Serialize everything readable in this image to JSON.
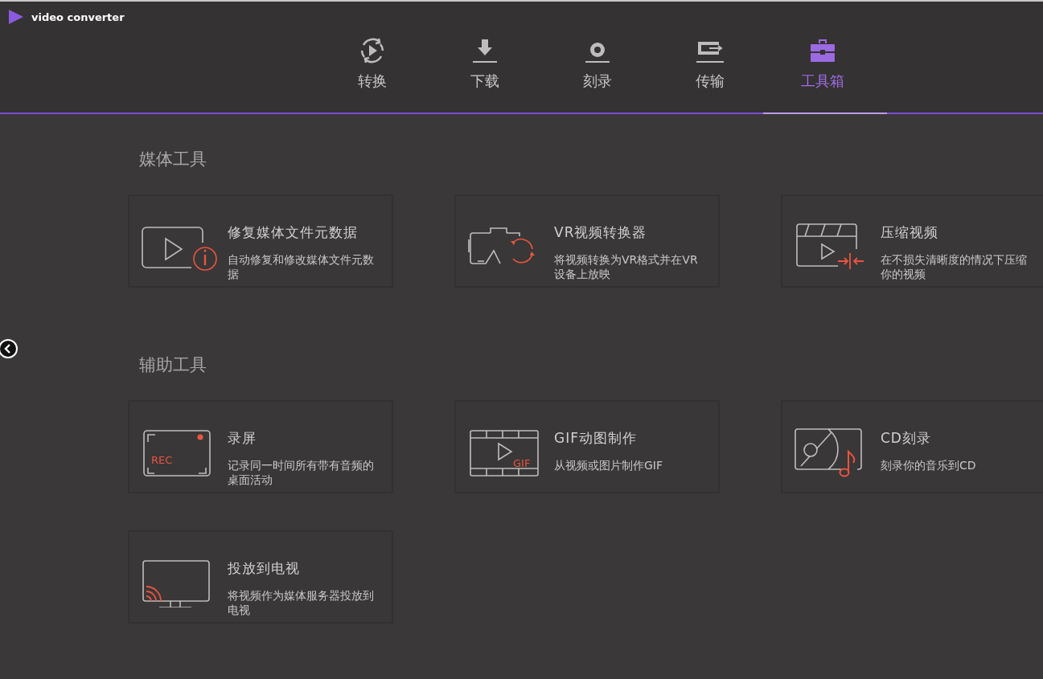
{
  "app": {
    "title": "video converter"
  },
  "tabs": [
    {
      "label": "转换",
      "kind": "convert",
      "selected": false
    },
    {
      "label": "下载",
      "kind": "download",
      "selected": false
    },
    {
      "label": "刻录",
      "kind": "burn",
      "selected": false
    },
    {
      "label": "传输",
      "kind": "transfer",
      "selected": false
    },
    {
      "label": "工具箱",
      "kind": "toolbox",
      "selected": true
    }
  ],
  "sections": [
    {
      "title": "媒体工具",
      "tools": [
        {
          "kind": "metadata",
          "name": "修复媒体文件元数据",
          "description": "自动修复和修改媒体文件元数据"
        },
        {
          "kind": "vr",
          "name": "VR视频转换器",
          "description": "将视频转换为VR格式并在VR设备上放映"
        },
        {
          "kind": "compress",
          "name": "压缩视频",
          "description": "在不损失清晰度的情况下压缩你的视频"
        }
      ]
    },
    {
      "title": "辅助工具",
      "tools": [
        {
          "kind": "record",
          "name": "录屏",
          "description": "记录同一时间所有带有音频的桌面活动",
          "icon_label": "REC"
        },
        {
          "kind": "gif",
          "name": "GIF动图制作",
          "description": "从视频或图片制作GIF",
          "icon_label": "GIF"
        },
        {
          "kind": "cd",
          "name": "CD刻录",
          "description": "刻录你的音乐到CD"
        },
        {
          "kind": "cast",
          "name": "投放到电视",
          "description": "将视频作为媒体服务器投放到电视"
        }
      ]
    }
  ]
}
